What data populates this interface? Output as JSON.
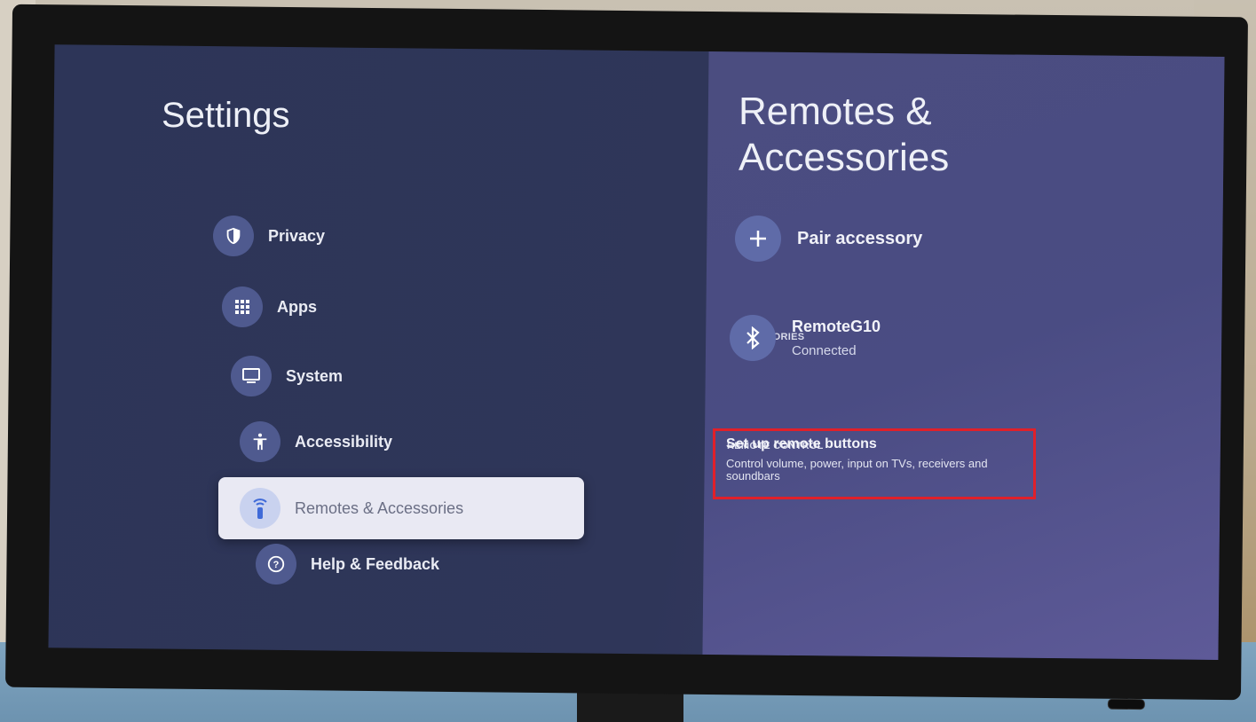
{
  "left_panel": {
    "title": "Settings",
    "items": [
      {
        "label": "Privacy",
        "icon": "shield-icon"
      },
      {
        "label": "Apps",
        "icon": "apps-grid-icon"
      },
      {
        "label": "System",
        "icon": "tv-icon"
      },
      {
        "label": "Accessibility",
        "icon": "accessibility-icon"
      },
      {
        "label": "Remotes & Accessories",
        "icon": "remote-icon",
        "selected": true
      },
      {
        "label": "Help & Feedback",
        "icon": "help-icon"
      }
    ]
  },
  "right_panel": {
    "title_line1": "Remotes &",
    "title_line2": "Accessories",
    "pair_label": "Pair accessory",
    "accessories_header": "ACCESSORIES",
    "device": {
      "name": "RemoteG10",
      "status": "Connected"
    },
    "remote_control_header": "REMOTE CONTROL",
    "setup": {
      "title": "Set up remote buttons",
      "description": "Control volume, power, input on TVs, receivers and soundbars"
    }
  },
  "colors": {
    "screen_bg": "#2f3659",
    "right_panel_bg": "#4a4c83",
    "highlight_box": "#e0202a",
    "selected_item_bg": "#e9e9f3"
  }
}
